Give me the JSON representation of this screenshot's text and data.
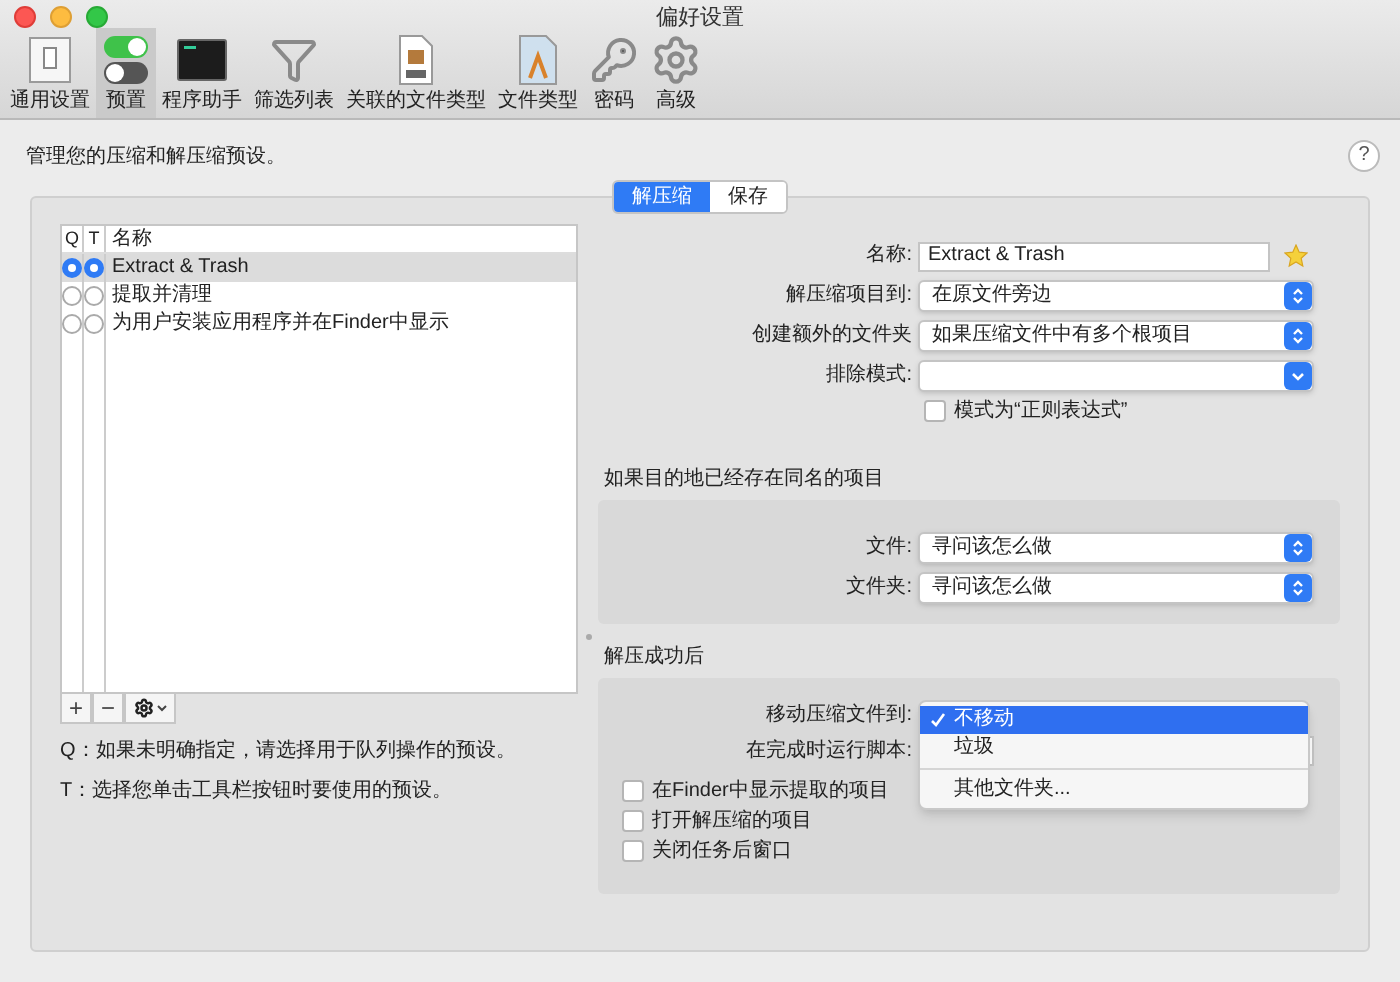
{
  "window": {
    "title": "偏好设置"
  },
  "toolbar": [
    {
      "label": "通用设置",
      "kind": "general",
      "selected": false
    },
    {
      "label": "预置",
      "kind": "presets",
      "selected": true
    },
    {
      "label": "程序助手",
      "kind": "terminal",
      "selected": false
    },
    {
      "label": "筛选列表",
      "kind": "filter",
      "selected": false
    },
    {
      "label": "关联的文件类型",
      "kind": "archive",
      "selected": false
    },
    {
      "label": "文件类型",
      "kind": "filetypes",
      "selected": false
    },
    {
      "label": "密码",
      "kind": "key",
      "selected": false
    },
    {
      "label": "高级",
      "kind": "gear",
      "selected": false
    }
  ],
  "header": "管理您的压缩和解压缩预设。",
  "help": "?",
  "segments": [
    {
      "label": "解压缩",
      "selected": true
    },
    {
      "label": "保存",
      "selected": false
    }
  ],
  "preset_list": {
    "columns": [
      "Q",
      "T",
      "名称"
    ],
    "rows": [
      {
        "name": "Extract & Trash",
        "q": true,
        "t": true,
        "selected": true
      },
      {
        "name": "提取并清理",
        "q": false,
        "t": false,
        "selected": false
      },
      {
        "name": "为用户安装应用程序并在Finder中显示",
        "q": false,
        "t": false,
        "selected": false
      }
    ]
  },
  "list_buttons": [
    "+",
    "−"
  ],
  "notes": [
    "Q：如果未明确指定，请选择用于队列操作的预设。",
    "T：选择您单击工具栏按钮时要使用的预设。"
  ],
  "form": [
    {
      "kind": "text",
      "label": "名称:",
      "value": "Extract & Trash"
    },
    {
      "kind": "popup",
      "label": "解压缩项目到:",
      "value": "在原文件旁边"
    },
    {
      "kind": "popup",
      "label": "创建额外的文件夹",
      "value": "如果压缩文件中有多个根项目"
    },
    {
      "kind": "combo",
      "label": "排除模式:"
    }
  ],
  "regex_checkbox": {
    "label": "模式为“正则表达式”",
    "checked": false
  },
  "exists_section": {
    "title": "如果目的地已经存在同名的项目",
    "rows": [
      {
        "label": "文件:",
        "value": "寻问该怎么做"
      },
      {
        "label": "文件夹:",
        "value": "寻问该怎么做"
      }
    ]
  },
  "success_section": {
    "title": "解压成功后",
    "move_label": "移动压缩文件到:",
    "script_label": "在完成时运行脚本:",
    "checkboxes": [
      {
        "label": "在Finder中显示提取的项目",
        "checked": false
      },
      {
        "label": "打开解压缩的项目",
        "checked": false
      },
      {
        "label": "关闭任务后窗口",
        "checked": false
      }
    ]
  },
  "popup_menu": {
    "groups": [
      [
        {
          "label": "不移动",
          "selected": true
        },
        {
          "label": "垃圾",
          "selected": false
        }
      ],
      [
        {
          "label": "其他文件夹...",
          "selected": false
        }
      ]
    ]
  }
}
